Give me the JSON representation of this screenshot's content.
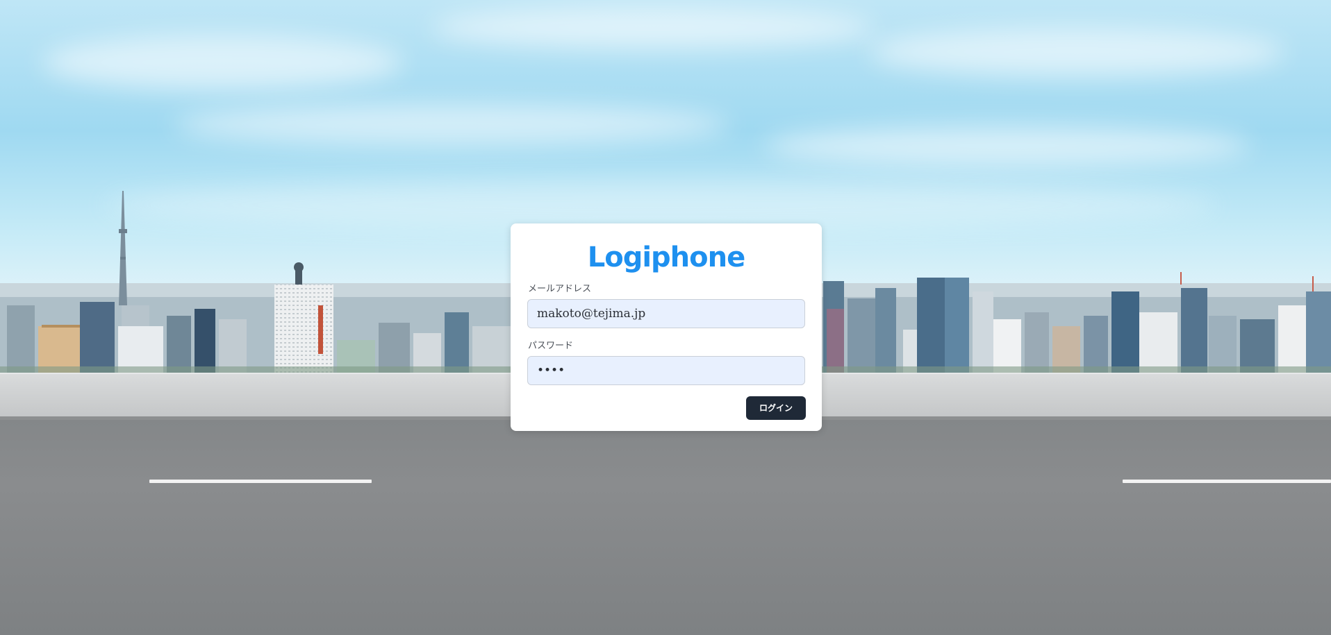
{
  "app": {
    "logo_text": "Logiphone"
  },
  "login_form": {
    "email_label": "メールアドレス",
    "email_value": "makoto@tejima.jp",
    "password_label": "パスワード",
    "password_value": "••••",
    "submit_label": "ログイン"
  },
  "colors": {
    "brand": "#1e90ef",
    "button": "#1f2937",
    "input_bg": "#e8f0fe"
  }
}
